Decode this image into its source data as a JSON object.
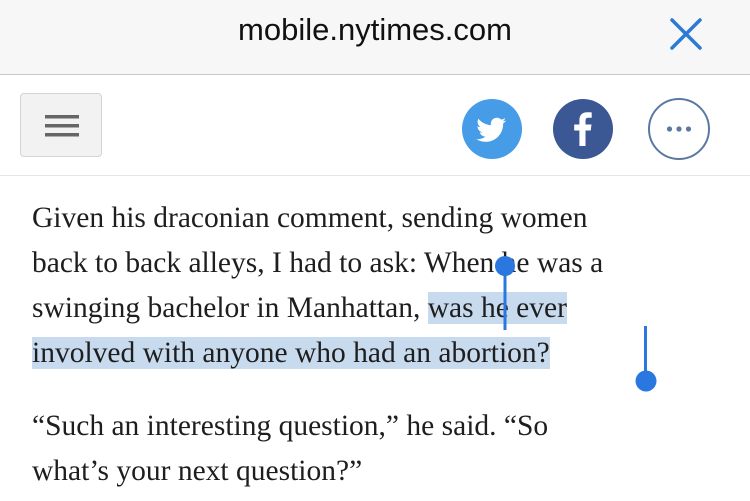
{
  "browser": {
    "url": "mobile.nytimes.com",
    "close_icon": "close-icon"
  },
  "toolbar": {
    "menu_icon": "hamburger-menu-icon",
    "share_buttons": [
      {
        "name": "twitter",
        "icon": "twitter-bird-icon",
        "color": "#479ce8"
      },
      {
        "name": "facebook",
        "icon": "facebook-f-icon",
        "color": "#3b5894"
      },
      {
        "name": "more",
        "icon": "more-dots-icon",
        "color": "#5b78a3"
      }
    ]
  },
  "article": {
    "para1": {
      "line1": "Given his draconian comment, sending women",
      "line2_plain": "back to back alleys, I had to ask: ",
      "line2_sel": "When he was a",
      "line3_plain": "swinging bachelor in Manhattan, ",
      "line3_sel": "was he ever",
      "line4_sel": "involved with anyone who had an abortion?"
    },
    "para2": {
      "line1": "“Such an interesting question,” he said. “So",
      "line2": "what’s your next question?”"
    },
    "selection_color": "#c8daed",
    "handle_color": "#2a77e0"
  }
}
